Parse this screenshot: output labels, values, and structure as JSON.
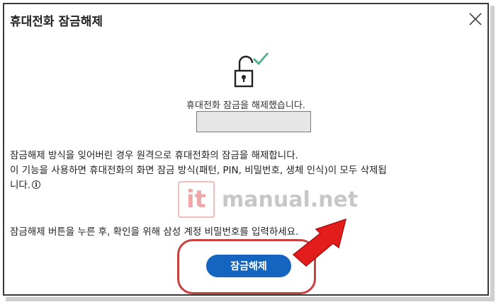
{
  "dialog": {
    "title": "휴대전화 잠금해제",
    "status_message": "휴대전화 잠금을 해제했습니다.",
    "description_line1": "잠금해제 방식을 잊어버린 경우 원격으로 휴대전화의 잠금을 해제합니다.",
    "description_line2": "이 기능을 사용하면 휴대전화의 화면 잠금 방식(패턴, PIN, 비밀번호, 생체 인식)이 모두 삭제됩",
    "description_line3": "니다.",
    "info_glyph": "i",
    "instruction": "잠금해제 버튼을 누른 후, 확인을 위해 삼성 계정 비밀번호를 입력하세요.",
    "unlock_button_label": "잠금해제"
  },
  "watermark": {
    "logo_text": "it",
    "site_text": "manual.net"
  },
  "icons": {
    "close": "close-icon",
    "lock": "unlocked-padlock-icon",
    "check": "checkmark-icon",
    "info": "info-icon"
  },
  "colors": {
    "button": "#1565c0",
    "checkmark": "#4caf8f",
    "highlight": "#c8413f",
    "arrow": "#e31c1c"
  }
}
